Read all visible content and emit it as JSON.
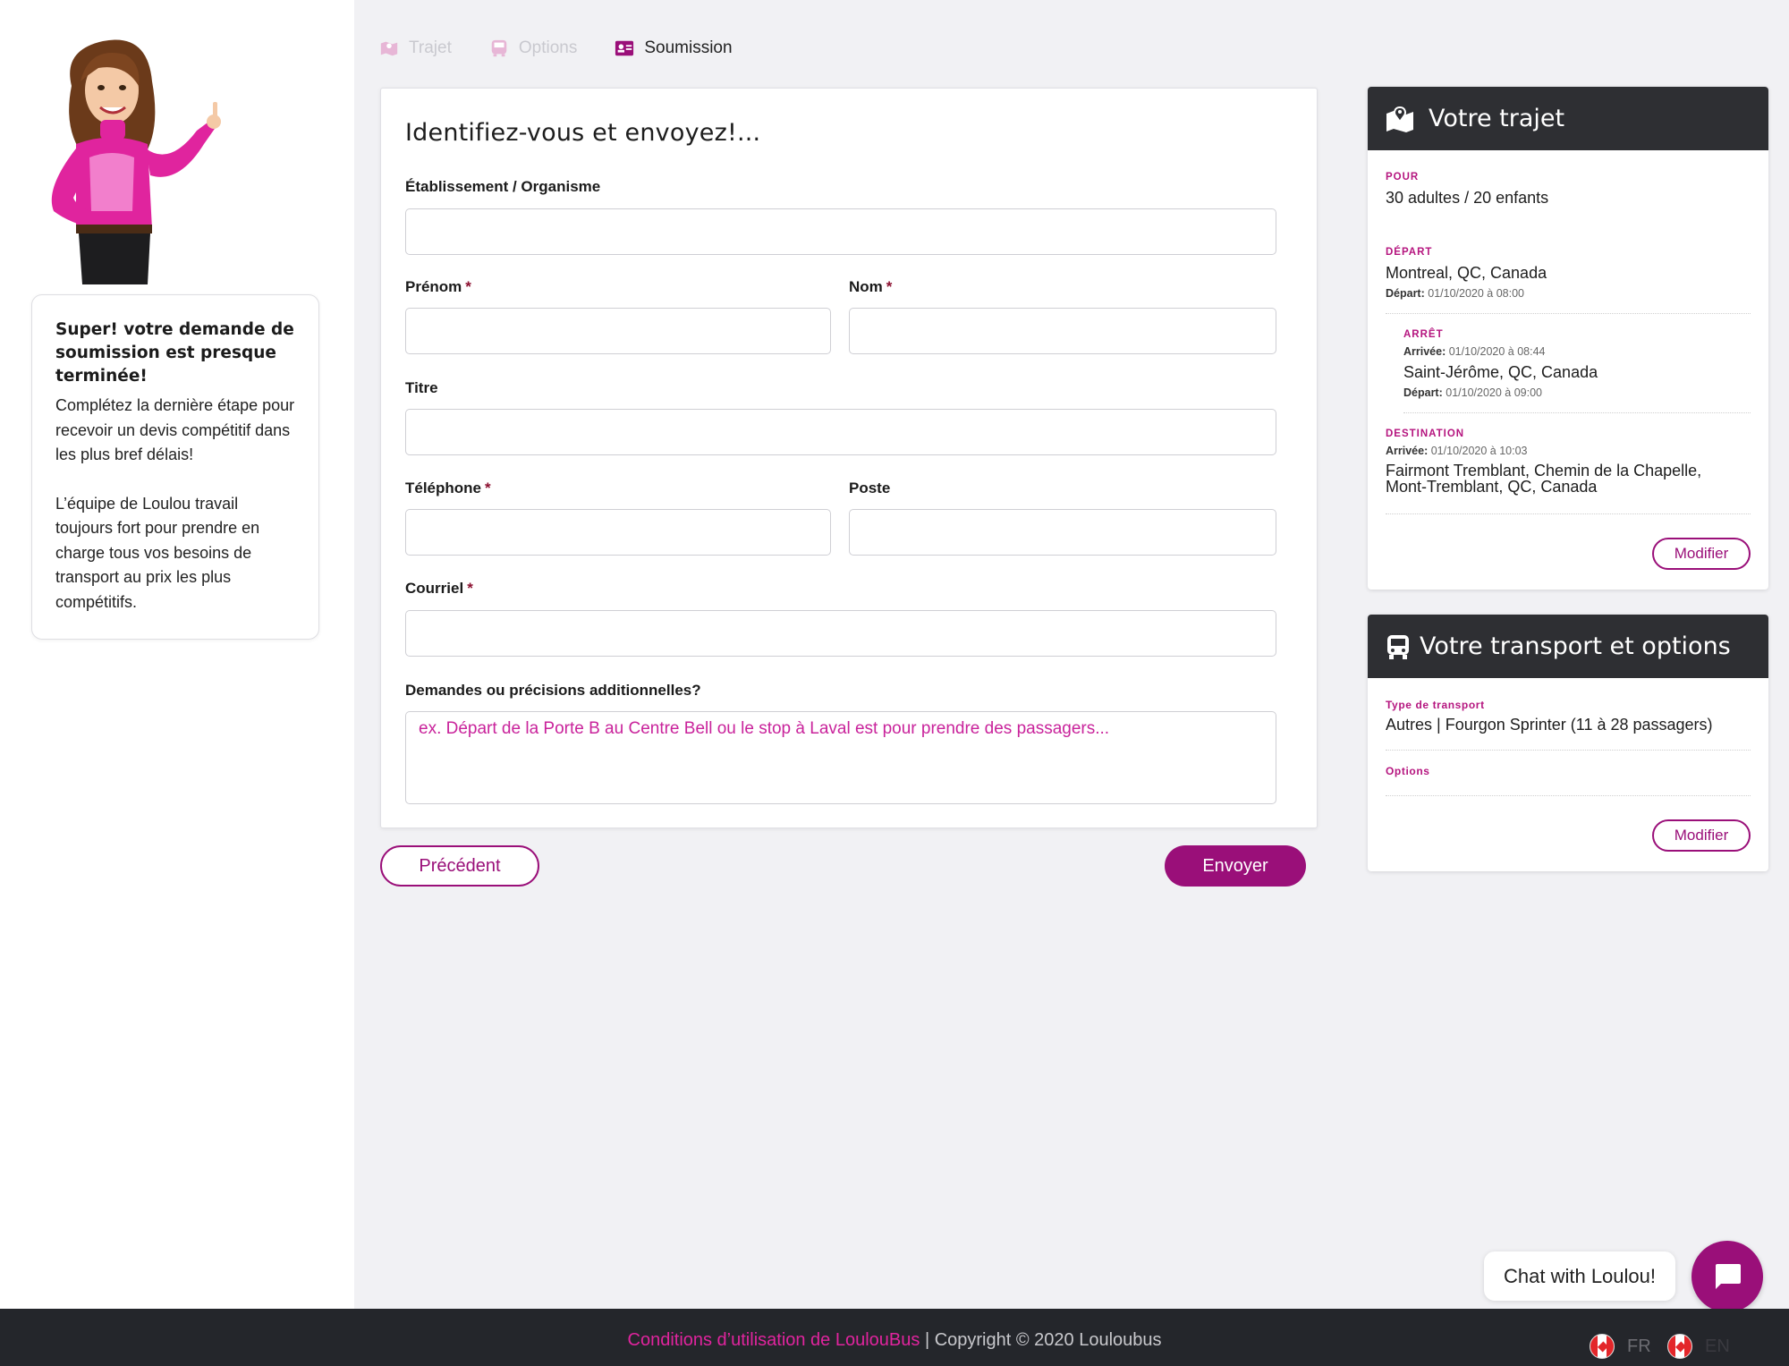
{
  "steps": [
    {
      "label": "Trajet",
      "state": "inactive"
    },
    {
      "label": "Options",
      "state": "inactive"
    },
    {
      "label": "Soumission",
      "state": "active"
    }
  ],
  "sidebar": {
    "title": "Super! votre demande de soumission  est presque terminée!",
    "body1": "Complétez la dernière étape pour recevoir un devis compétitif dans les plus bref délais!",
    "body2": "L’équipe de Loulou travail toujours fort pour prendre en charge tous vos besoins de transport au prix les plus compétitifs."
  },
  "form": {
    "title": "Identifiez-vous et envoyez!...",
    "fields": {
      "etablissement": {
        "label": "Établissement / Organisme",
        "value": ""
      },
      "prenom": {
        "label": "Prénom",
        "required": "*",
        "value": ""
      },
      "nom": {
        "label": "Nom",
        "required": "*",
        "value": ""
      },
      "titre": {
        "label": "Titre",
        "value": ""
      },
      "telephone": {
        "label": "Téléphone",
        "required": "*",
        "value": ""
      },
      "poste": {
        "label": "Poste",
        "value": ""
      },
      "courriel": {
        "label": "Courriel",
        "required": "*",
        "value": ""
      },
      "demandes": {
        "label": "Demandes ou précisions additionnelles?",
        "placeholder": "ex. Départ de la Porte B au Centre Bell ou le stop à Laval est pour prendre des passagers..."
      }
    },
    "prev_label": "Précédent",
    "send_label": "Envoyer"
  },
  "trip": {
    "title": "Votre trajet",
    "pour_label": "POUR",
    "pour_value": "30 adultes / 20 enfants",
    "depart_label": "DÉPART",
    "depart_value": "Montreal, QC, Canada",
    "depart_note_key": "Départ:",
    "depart_note_val": "01/10/2020 à 08:00",
    "arret_label": "ARRÊT",
    "arret_arrival_key": "Arrivée:",
    "arret_arrival_val": "01/10/2020 à 08:44",
    "arret_value": "Saint-Jérôme, QC, Canada",
    "arret_depart_key": "Départ:",
    "arret_depart_val": "01/10/2020 à 09:00",
    "dest_label": "DESTINATION",
    "dest_arrival_key": "Arrivée:",
    "dest_arrival_val": "01/10/2020 à 10:03",
    "dest_value_line1": "Fairmont Tremblant, Chemin de la Chapelle,",
    "dest_value_line2": "Mont-Tremblant, QC, Canada",
    "modify_label": "Modifier"
  },
  "transport": {
    "title": "Votre transport et options",
    "type_label": "Type de transport",
    "type_value": "Autres | Fourgon Sprinter (11 à 28 passagers)",
    "options_label": "Options",
    "modify_label": "Modifier"
  },
  "chat": {
    "label": "Chat with Loulou!"
  },
  "footer": {
    "link": "Conditions d’utilisation de LoulouBus",
    "copyright": " | Copyright © 2020 Louloubus",
    "lang_fr": "FR",
    "lang_en": "EN"
  },
  "colors": {
    "accent": "#9a0f79",
    "pink": "#e0249e",
    "dark_header": "#2e2f33",
    "footer": "#24262b"
  }
}
